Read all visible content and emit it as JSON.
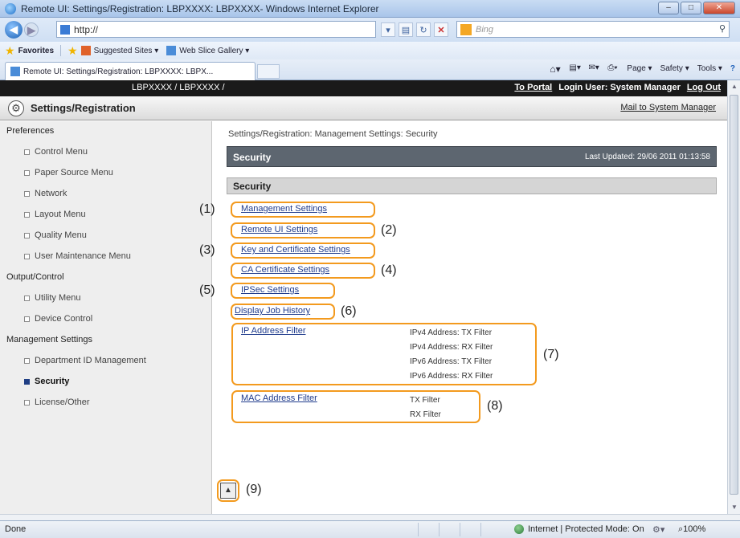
{
  "window": {
    "title": "Remote UI: Settings/Registration: LBPXXXX: LBPXXXX- Windows Internet Explorer",
    "buttons": [
      "–",
      "□",
      "✕"
    ]
  },
  "address_bar": {
    "url": "http://",
    "search_placeholder": "Bing"
  },
  "favorites_bar": {
    "favorites_label": "Favorites",
    "suggested_sites": "Suggested Sites ▾",
    "web_slice_gallery": "Web Slice Gallery ▾"
  },
  "tab": {
    "title": "Remote UI: Settings/Registration: LBPXXXX: LBPX..."
  },
  "command_bar": {
    "page": "Page ▾",
    "safety": "Safety ▾",
    "tools": "Tools ▾"
  },
  "header": {
    "printer_name": "LBPXXXX / LBPXXXX /",
    "to_portal": "To Portal",
    "login_user": "Login User: System Manager",
    "log_out": "Log Out",
    "section_title": "Settings/Registration",
    "mail_to": "Mail to System Manager"
  },
  "sidebar": {
    "groups": [
      {
        "label": "Preferences",
        "items": [
          "Control Menu",
          "Paper Source Menu",
          "Network",
          "Layout Menu",
          "Quality Menu",
          "User Maintenance Menu"
        ]
      },
      {
        "label": "Output/Control",
        "items": [
          "Utility Menu",
          "Device Control"
        ]
      },
      {
        "label": "Management Settings",
        "items": [
          "Department ID Management",
          "Security",
          "License/Other"
        ]
      }
    ],
    "active": "Security"
  },
  "main": {
    "breadcrumb": "Settings/Registration: Management Settings: Security",
    "title_bar": "Security",
    "last_updated": "Last Updated: 29/06 2011 01:13:58",
    "sub_bar": "Security",
    "links": {
      "management_settings": "Management Settings",
      "remote_ui_settings": "Remote UI Settings",
      "key_cert_settings": "Key and Certificate Settings",
      "ca_cert_settings": "CA Certificate Settings",
      "ipsec_settings": "IPSec Settings",
      "display_job_history": "Display Job History",
      "ip_address_filter": "IP Address Filter",
      "mac_address_filter": "MAC Address Filter"
    },
    "ip_filter_items": [
      "IPv4 Address: TX Filter",
      "IPv4 Address: RX Filter",
      "IPv6 Address: TX Filter",
      "IPv6 Address: RX Filter"
    ],
    "mac_filter_items": [
      "TX Filter",
      "RX Filter"
    ],
    "callouts": [
      "(1)",
      "(2)",
      "(3)",
      "(4)",
      "(5)",
      "(6)",
      "(7)",
      "(8)",
      "(9)"
    ],
    "highlight_color": "#f39a1e"
  },
  "status_bar": {
    "status": "Done",
    "zone": "Internet | Protected Mode: On",
    "zoom": "⌕100%"
  }
}
